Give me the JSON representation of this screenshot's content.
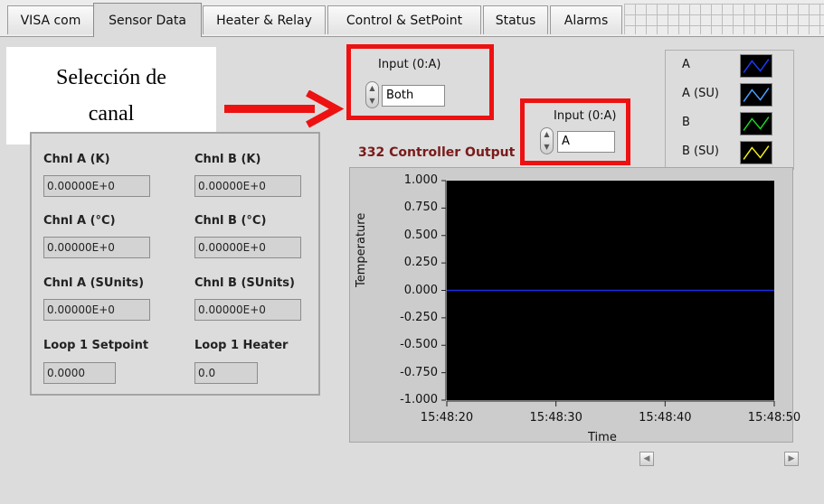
{
  "tabs": [
    {
      "label": "VISA com",
      "active": false
    },
    {
      "label": "Sensor Data",
      "active": true
    },
    {
      "label": "Heater & Relay",
      "active": false
    },
    {
      "label": "Control & SetPoint",
      "active": false
    },
    {
      "label": "Status",
      "active": false
    },
    {
      "label": "Alarms",
      "active": false
    }
  ],
  "annotation": {
    "line1": "Selección de",
    "line2": "canal"
  },
  "input_control_1": {
    "label": "Input (0:A)",
    "value": "Both"
  },
  "input_control_2": {
    "label": "Input (0:A)",
    "value": "A"
  },
  "readouts": {
    "chnl_a_k": {
      "label": "Chnl A (K)",
      "value": "0.00000E+0"
    },
    "chnl_b_k": {
      "label": "Chnl B (K)",
      "value": "0.00000E+0"
    },
    "chnl_a_c": {
      "label": "Chnl A (°C)",
      "value": "0.00000E+0"
    },
    "chnl_b_c": {
      "label": "Chnl B (°C)",
      "value": "0.00000E+0"
    },
    "chnl_a_su": {
      "label": "Chnl A (SUnits)",
      "value": "0.00000E+0"
    },
    "chnl_b_su": {
      "label": "Chnl B (SUnits)",
      "value": "0.00000E+0"
    },
    "loop1_setpoint": {
      "label": "Loop 1 Setpoint",
      "value": "0.0000"
    },
    "loop1_heater": {
      "label": "Loop 1 Heater",
      "value": "0.0"
    }
  },
  "legend": [
    {
      "name": "A",
      "color": "#1a3bff"
    },
    {
      "name": "A (SU)",
      "color": "#4aa0ff"
    },
    {
      "name": "B",
      "color": "#1ed81e"
    },
    {
      "name": "B (SU)",
      "color": "#f2f21a"
    }
  ],
  "chart_data": {
    "type": "line",
    "title": "332 Controller Output",
    "xlabel": "Time",
    "ylabel": "Temperature",
    "y_ticks": [
      "1.000",
      "0.750",
      "0.500",
      "0.250",
      "0.000",
      "-0.250",
      "-0.500",
      "-0.750",
      "-1.000"
    ],
    "x_ticks": [
      "15:48:20",
      "15:48:30",
      "15:48:40",
      "15:48:50"
    ],
    "ylim": [
      -1.0,
      1.0
    ],
    "xlim": [
      "15:48:20",
      "15:48:50"
    ],
    "series": [
      {
        "name": "A",
        "color": "#1a2ee0",
        "x": [
          "15:48:20",
          "15:48:50"
        ],
        "values": [
          0.0,
          0.0
        ]
      }
    ],
    "background": "#000000"
  }
}
